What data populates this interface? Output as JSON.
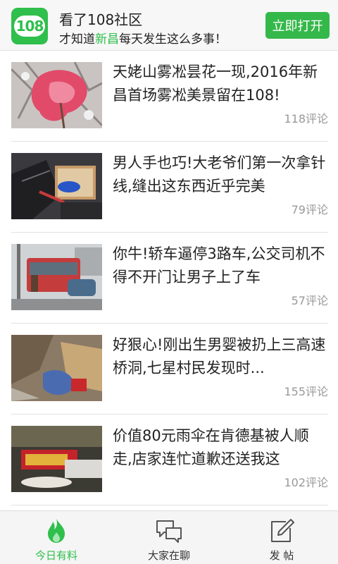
{
  "banner": {
    "logo_text": "108",
    "title": "看了108社区",
    "subtitle_before": "才知道",
    "subtitle_highlight": "新昌",
    "subtitle_after": "每天发生这么多事！",
    "open_button": "立即打开"
  },
  "feed": [
    {
      "title": "天姥山雾凇昙花一现,2016年新昌首场雾凇美景留在108!",
      "comments": "118评论",
      "thumb": "frost-flower"
    },
    {
      "title": "男人手也巧!大老爷们第一次拿针线,缝出这东西近乎完美",
      "comments": "79评论",
      "thumb": "sewing"
    },
    {
      "title": "你牛!轿车逼停3路车,公交司机不得不开门让男子上了车",
      "comments": "57评论",
      "thumb": "bus"
    },
    {
      "title": "好狠心!刚出生男婴被扔上三高速桥洞,七星村民发现时...",
      "comments": "155评论",
      "thumb": "box"
    },
    {
      "title": "价值80元雨伞在肯德基被人顺走,店家连忙道歉还送我这",
      "comments": "102评论",
      "thumb": "gift"
    }
  ],
  "tabs": [
    {
      "label": "今日有料",
      "icon": "flame-icon",
      "active": true
    },
    {
      "label": "大家在聊",
      "icon": "chat-bubbles-icon",
      "active": false
    },
    {
      "label": "发 帖",
      "icon": "edit-post-icon",
      "active": false
    }
  ],
  "colors": {
    "accent": "#2fbf4c",
    "button": "#35b84a",
    "muted": "#999999"
  }
}
